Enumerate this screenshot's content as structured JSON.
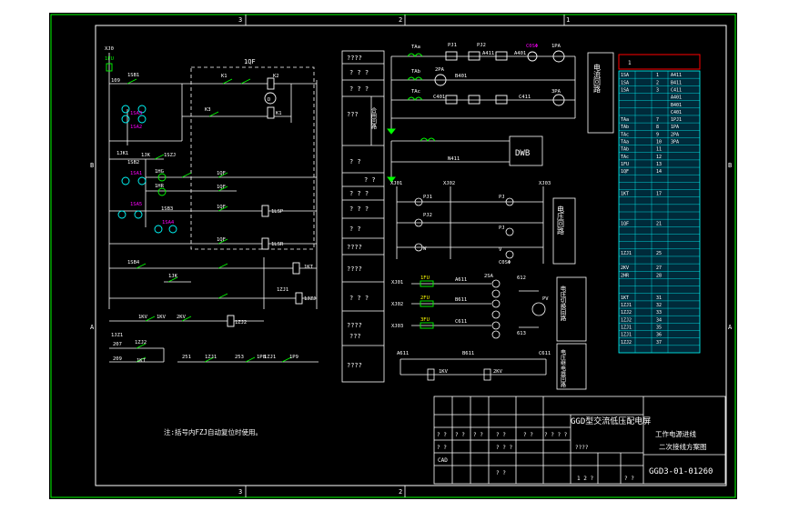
{
  "frame": {
    "zone_top": [
      "3",
      "2",
      "1"
    ],
    "zone_bottom": [
      "3",
      "2"
    ],
    "zone_side": [
      "B",
      "A"
    ]
  },
  "control_circuit": {
    "title_qf": "1QF",
    "labels": [
      "1FU",
      "XJ0",
      "1SB1",
      "109",
      "K1",
      "K2",
      "K3",
      "K1",
      "1SA3",
      "1SA2",
      "1SA1",
      "1JK1",
      "1JK",
      "1SZJ",
      "1HG",
      "1HR",
      "1SB2",
      "1SB3",
      "1SA4",
      "1SA5",
      "1SB4",
      "1JZ1",
      "1JK",
      "1JZJ",
      "1KV",
      "2KV",
      "1KV",
      "1ZJ2",
      "207",
      "209",
      "1ZJ2",
      "1KT",
      "251",
      "253",
      "1ZJ1",
      "1ZJ1",
      "1P8",
      "1P9",
      "1QF",
      "1QF",
      "1QF",
      "1QF",
      "1LSP",
      "1LSR",
      "1KT",
      "1ZJ1",
      "D"
    ],
    "note": "注:括号内FZJ自动复位时使用。"
  },
  "middle_table": {
    "rows": [
      "????",
      "? ? ?",
      "? ? ?",
      "???",
      "合闸回路",
      "? ?",
      "? ?",
      "? ? ?",
      "? ? ?",
      "? ?",
      "????",
      "????",
      "? ? ?",
      "????",
      "???",
      "????"
    ]
  },
  "right_circuit": {
    "labels": [
      "TAa",
      "PJ1",
      "PJ2",
      "A411",
      "A401",
      "C0SΦ",
      "1PA",
      "TAb",
      "2PA",
      "B401",
      "TAc",
      "C401",
      "C411",
      "3PA",
      "N411",
      "DWB",
      "XJ01",
      "XJ02",
      "XJ03",
      "PJ1",
      "PJ2",
      "PJ",
      "PJ",
      "W",
      "V",
      "C0SΦ",
      "1FU",
      "2FU",
      "3FU",
      "A611",
      "B611",
      "C611",
      "2SA",
      "612",
      "613",
      "PV",
      "1KV",
      "2KV",
      "A611",
      "B611",
      "C611"
    ],
    "section_current": "电流回路",
    "section_voltage": "电压回路",
    "section_switch": "电压切换回路",
    "section_relay": "电压继电器回路"
  },
  "terminal_block": {
    "header": "1",
    "rows": [
      "1SA",
      "1SA",
      "1SA",
      "TAa",
      "TAb",
      "TAc",
      "TAa",
      "TAb",
      "TAc",
      "1FU",
      "1QF",
      "1KT",
      "1QF",
      "1ZJ1",
      "2KV",
      "2HR",
      "1KT",
      "1ZJ1",
      "1ZJ2",
      "1ZJ2",
      "1ZJ1",
      "1ZJ1",
      "1ZJ2"
    ],
    "cols": [
      "A411",
      "B411",
      "C411",
      "A401",
      "B401",
      "C401",
      "1PJ1",
      "1PA",
      "2PA",
      "3PA"
    ]
  },
  "title_block": {
    "series_title": "GGD型交流低压配电屏",
    "drawing_name_line1": "工作电源进线",
    "drawing_name_line2": "二次接线方案图",
    "drawing_number": "GGD3-01-01260",
    "cells": [
      "? ?",
      "? ?",
      "? ?",
      "? ?",
      "? ?",
      "? ?",
      "? ? ? ?",
      "CAD",
      "? ? ?",
      "????",
      "? ?",
      "1 2 ?",
      "? ?"
    ]
  },
  "colors": {
    "background": "#000000",
    "frame": "#ffffff",
    "wire": "#ffffff",
    "green": "#00ff00",
    "magenta": "#ff00ff",
    "cyan": "#00ffff",
    "red": "#ff0000",
    "yellow": "#ffff00",
    "terminal_fill": "#003344",
    "outer_bg": "#ffffff"
  }
}
